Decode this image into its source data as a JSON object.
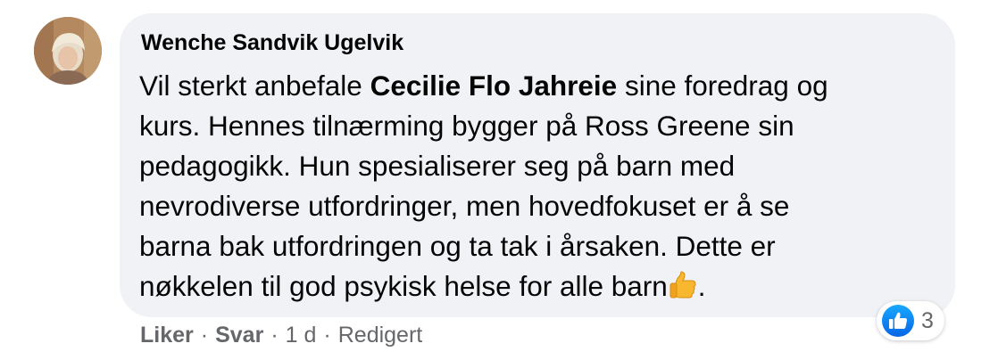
{
  "comment": {
    "author": "Wenche Sandvik Ugelvik",
    "lines": [
      {
        "before": "Vil sterkt anbefale ",
        "bold": "Cecilie Flo Jahreie",
        "after": " sine foredrag og"
      },
      {
        "text": "kurs. Hennes tilnærming bygger på Ross Greene sin"
      },
      {
        "text": "pedagogikk. Hun spesialiserer seg på barn med"
      },
      {
        "text": "nevrodiverse utfordringer, men hovedfokuset er å se"
      },
      {
        "text": "barna bak utfordringen og ta tak i årsaken. Dette er"
      },
      {
        "before": "nøkkelen til god psykisk helse for alle barn",
        "emoji": "thumbs-up-emoji",
        "after": "."
      }
    ]
  },
  "reactions": {
    "icon": "like-icon",
    "count": "3",
    "color": "#1877f2"
  },
  "actions": {
    "like": "Liker",
    "separator": "·",
    "reply": "Svar",
    "time": "1 d",
    "edited": "Redigert"
  }
}
